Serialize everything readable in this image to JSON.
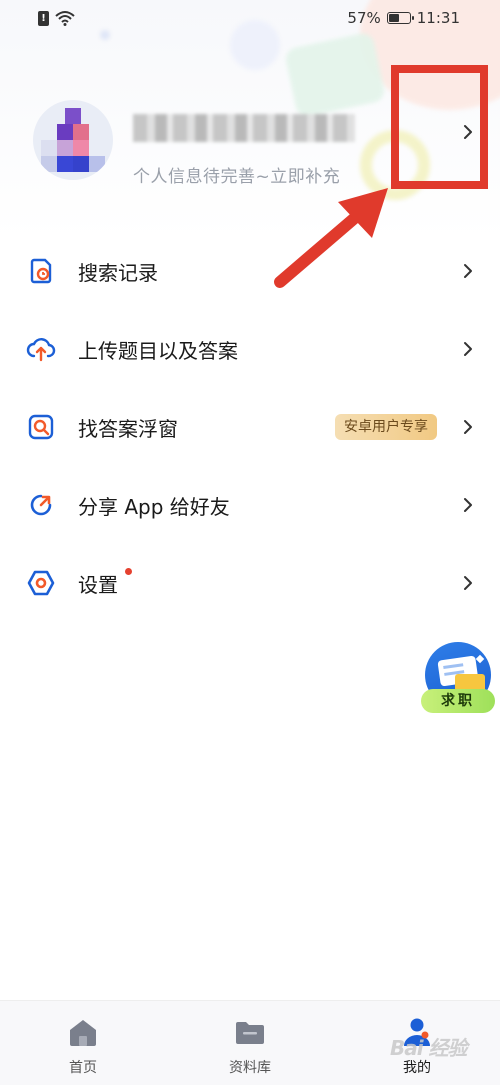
{
  "status_bar": {
    "battery_percent": "57%",
    "battery_level": 0.57,
    "time": "11:31"
  },
  "profile": {
    "hint": "个人信息待完善~立即补充",
    "username_obscured": true
  },
  "menu": {
    "items": [
      {
        "label": "搜索记录",
        "icon": "search-history-icon"
      },
      {
        "label": "上传题目以及答案",
        "icon": "cloud-upload-icon"
      },
      {
        "label": "找答案浮窗",
        "icon": "find-answer-window-icon",
        "badge": "安卓用户专享"
      },
      {
        "label": "分享 App 给好友",
        "icon": "share-icon"
      },
      {
        "label": "设置",
        "icon": "settings-icon",
        "has_notification_dot": true
      }
    ]
  },
  "float_button": {
    "label": "求职"
  },
  "bottom_nav": {
    "items": [
      {
        "label": "首页",
        "icon": "home-icon"
      },
      {
        "label": "资料库",
        "icon": "folder-icon"
      },
      {
        "label": "我的",
        "icon": "user-icon",
        "active": true
      }
    ]
  },
  "watermark": {
    "text": "Bai 经验"
  },
  "colors": {
    "accent_blue": "#1c5fd6",
    "accent_orange": "#f25a2a",
    "annotation_red": "#e03a2c",
    "badge_gold": "#f1c983"
  }
}
